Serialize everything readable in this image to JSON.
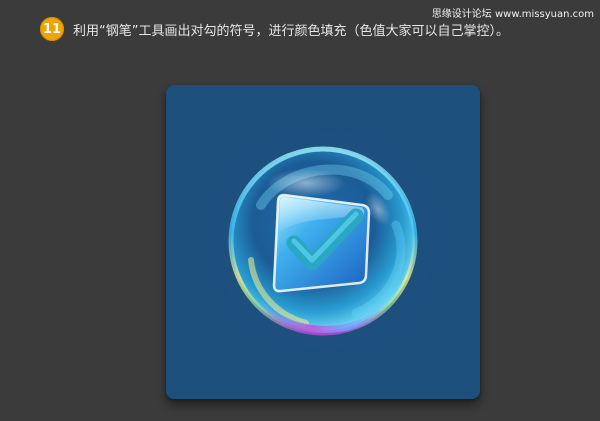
{
  "watermark": {
    "text": "思缘设计论坛 www.missyuan.com"
  },
  "step": {
    "number": "11",
    "text": "利用“钢笔”工具画出对勾的符号，进行颜色填充（色值大家可以自己掌控）。"
  },
  "illustration": {
    "card_color": "#1d4f7d",
    "bubble_color": "#3fc9ff",
    "rim_colors": [
      "#f6f28c",
      "#9adf9a",
      "#b04bd9"
    ],
    "tile_color": "#2c7fd8",
    "check_color": "#2aa6c6",
    "icon": "checkbox-checkmark-icon"
  }
}
